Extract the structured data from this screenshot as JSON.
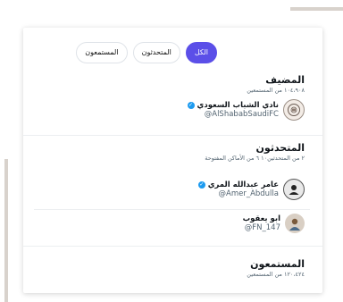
{
  "tabs": [
    {
      "label": "الكل",
      "active": true
    },
    {
      "label": "المتحدثون",
      "active": false
    },
    {
      "label": "المستمعون",
      "active": false
    }
  ],
  "host_section": {
    "title": "المضيف",
    "subtitle": "١٠٤،٩٠٨ من المستمعين",
    "user": {
      "name": "نادي الشباب السعودي",
      "handle": "@AlShababSaudiFC",
      "verified": true,
      "avatar_icon": "club-crest-icon"
    }
  },
  "speakers_section": {
    "title": "المتحدثون",
    "subtitle": "٢ من المتحدثين١٠ ٦ من الأماكن المفتوحة",
    "users": [
      {
        "name": "عامر عبدالله المري",
        "handle": "@Amer_Abdulla",
        "verified": true,
        "avatar_icon": "profile-photo-icon"
      },
      {
        "name": "ابو يعقوب",
        "handle": "@FN_147",
        "verified": false,
        "avatar_icon": "profile-photo-icon"
      }
    ]
  },
  "listeners_section": {
    "title": "المستمعون",
    "subtitle": "١٢٠،٤٢٤ من المستمعين"
  },
  "colors": {
    "accent": "#5b4fe8",
    "verified": "#1d9bf0"
  }
}
